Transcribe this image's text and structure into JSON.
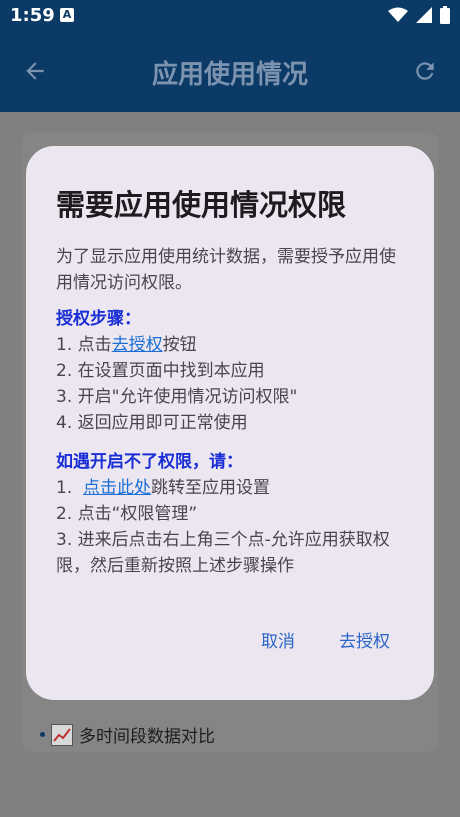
{
  "statusbar": {
    "time": "1:59",
    "a_icon": "A"
  },
  "appbar": {
    "title": "应用使用情况"
  },
  "background": {
    "item_label": "多时间段数据对比"
  },
  "dialog": {
    "title": "需要应用使用情况权限",
    "intro": "为了显示应用使用统计数据，需要授予应用使用情况访问权限。",
    "steps_title": "授权步骤：",
    "step1_prefix": "1. 点击",
    "step1_link": "去授权",
    "step1_suffix": "按钮",
    "step2": "2. 在设置页面中找到本应用",
    "step3": "3. 开启\"允许使用情况访问权限\"",
    "step4": "4. 返回应用即可正常使用",
    "fallback_title": "如遇开启不了权限，请：",
    "fb1_prefix": "1.  ",
    "fb1_link": "点击此处",
    "fb1_suffix": "跳转至应用设置",
    "fb2": "2. 点击“权限管理”",
    "fb3": "3. 进来后点击右上角三个点-允许应用获取权限，然后重新按照上述步骤操作",
    "cancel": "取消",
    "authorize": "去授权"
  }
}
